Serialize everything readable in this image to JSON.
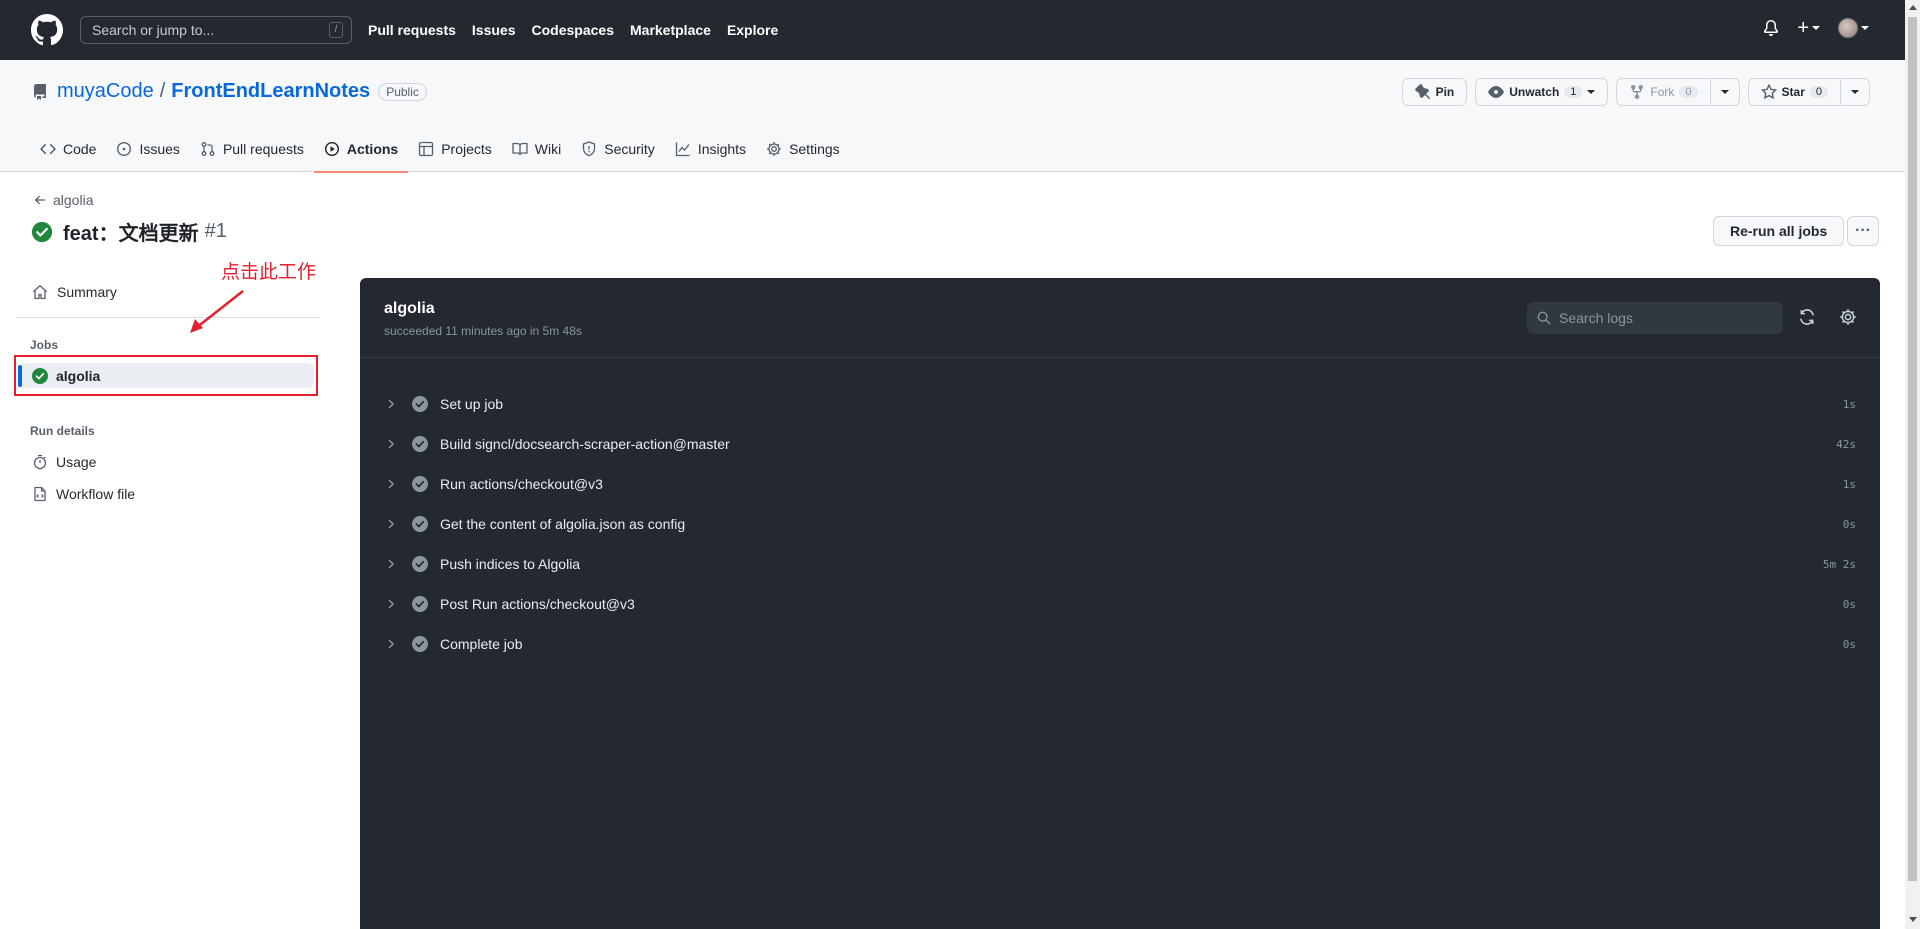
{
  "header": {
    "search_placeholder": "Search or jump to...",
    "search_shortcut": "/",
    "nav": [
      "Pull requests",
      "Issues",
      "Codespaces",
      "Marketplace",
      "Explore"
    ],
    "plus_label": "+"
  },
  "repo": {
    "owner": "muyaCode",
    "separator": "/",
    "name": "FrontEndLearnNotes",
    "visibility": "Public",
    "pin_label": "Pin",
    "unwatch_label": "Unwatch",
    "watch_count": "1",
    "fork_label": "Fork",
    "fork_count": "0",
    "star_label": "Star",
    "star_count": "0",
    "tabs": [
      {
        "label": "Code",
        "icon": "code-icon"
      },
      {
        "label": "Issues",
        "icon": "issue-icon"
      },
      {
        "label": "Pull requests",
        "icon": "pull-request-icon"
      },
      {
        "label": "Actions",
        "icon": "play-icon"
      },
      {
        "label": "Projects",
        "icon": "table-icon"
      },
      {
        "label": "Wiki",
        "icon": "book-icon"
      },
      {
        "label": "Security",
        "icon": "shield-icon"
      },
      {
        "label": "Insights",
        "icon": "graph-icon"
      },
      {
        "label": "Settings",
        "icon": "gear-icon"
      }
    ],
    "active_tab": "Actions"
  },
  "run": {
    "back_label": "algolia",
    "title": "feat：文档更新",
    "number": "#1",
    "rerun_label": "Re-run all jobs",
    "more_label": "···"
  },
  "sidebar": {
    "summary_label": "Summary",
    "jobs_heading": "Jobs",
    "job_label": "algolia",
    "run_details_heading": "Run details",
    "usage_label": "Usage",
    "workflow_file_label": "Workflow file"
  },
  "annotation": {
    "text": "点击此工作"
  },
  "log": {
    "job_title": "algolia",
    "status_line": "succeeded 11 minutes ago in 5m 48s",
    "search_placeholder": "Search logs",
    "steps": [
      {
        "name": "Set up job",
        "duration": "1s"
      },
      {
        "name": "Build signcl/docsearch-scraper-action@master",
        "duration": "42s"
      },
      {
        "name": "Run actions/checkout@v3",
        "duration": "1s"
      },
      {
        "name": "Get the content of algolia.json as config",
        "duration": "0s"
      },
      {
        "name": "Push indices to Algolia",
        "duration": "5m 2s"
      },
      {
        "name": "Post Run actions/checkout@v3",
        "duration": "0s"
      },
      {
        "name": "Complete job",
        "duration": "0s"
      }
    ]
  },
  "colors": {
    "header_bg": "#24292f",
    "link": "#0969da",
    "success": "#1f883d",
    "active_tab_underline": "#fd8c73",
    "annotation_red": "#e5202e",
    "log_bg": "#24292f"
  }
}
